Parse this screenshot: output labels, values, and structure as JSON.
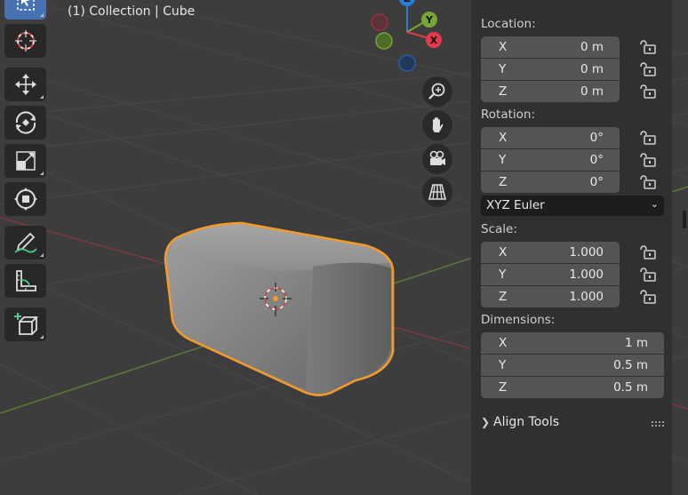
{
  "header": {
    "title": "(1) Collection | Cube"
  },
  "toolbar": {
    "tools": [
      "select-box",
      "cursor",
      "move",
      "rotate",
      "scale",
      "transform",
      "annotate",
      "measure",
      "add-cube"
    ],
    "active": "select-box"
  },
  "gizmo": {
    "axes": {
      "x": "X",
      "y": "Y",
      "z": "Z"
    },
    "colors": {
      "x": "#e23a4c",
      "y": "#77a632",
      "z": "#2a7dd7"
    },
    "buttons": [
      "zoom-icon",
      "hand-pan-icon",
      "camera-icon",
      "grid-perspective-icon"
    ]
  },
  "sidebar": {
    "location_label": "Location:",
    "location": [
      {
        "axis": "X",
        "value": "0 m"
      },
      {
        "axis": "Y",
        "value": "0 m"
      },
      {
        "axis": "Z",
        "value": "0 m"
      }
    ],
    "rotation_label": "Rotation:",
    "rotation": [
      {
        "axis": "X",
        "value": "0°"
      },
      {
        "axis": "Y",
        "value": "0°"
      },
      {
        "axis": "Z",
        "value": "0°"
      }
    ],
    "rotation_mode": "XYZ Euler",
    "scale_label": "Scale:",
    "scale": [
      {
        "axis": "X",
        "value": "1.000"
      },
      {
        "axis": "Y",
        "value": "1.000"
      },
      {
        "axis": "Z",
        "value": "1.000"
      }
    ],
    "dimensions_label": "Dimensions:",
    "dimensions": [
      {
        "axis": "X",
        "value": "1 m"
      },
      {
        "axis": "Y",
        "value": "0.5 m"
      },
      {
        "axis": "Z",
        "value": "0.5 m"
      }
    ],
    "align_tools_label": "Align Tools"
  },
  "colors": {
    "viewport_bg": "#3d3d3d",
    "sidebar_bg": "#303030",
    "field_bg": "#545454",
    "selection_outline": "#f09b2c",
    "active_tool": "#4772b3"
  }
}
